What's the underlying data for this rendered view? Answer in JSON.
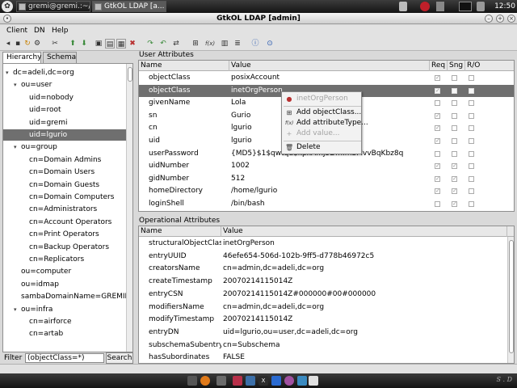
{
  "taskbar": {
    "tasks": [
      "gremi@gremi.:~/...",
      "GtkOL LDAP [a..."
    ],
    "clock": "12:50"
  },
  "window": {
    "title": "GtkOL LDAP [admin]"
  },
  "menu": [
    "Client",
    "DN",
    "Help"
  ],
  "tabs": [
    "Hierarchy",
    "Schema"
  ],
  "tree": [
    {
      "label": "dc=adeli,dc=org",
      "level": 0,
      "twisty": "expanded"
    },
    {
      "label": "ou=user",
      "level": 1,
      "twisty": "expanded"
    },
    {
      "label": "uid=nobody",
      "level": 2,
      "twisty": "none"
    },
    {
      "label": "uid=root",
      "level": 2,
      "twisty": "none"
    },
    {
      "label": "uid=gremi",
      "level": 2,
      "twisty": "none"
    },
    {
      "label": "uid=lgurio",
      "level": 2,
      "twisty": "none"
    },
    {
      "label": "ou=group",
      "level": 1,
      "twisty": "expanded"
    },
    {
      "label": "cn=Domain Admins",
      "level": 2,
      "twisty": "none"
    },
    {
      "label": "cn=Domain Users",
      "level": 2,
      "twisty": "none"
    },
    {
      "label": "cn=Domain Guests",
      "level": 2,
      "twisty": "none"
    },
    {
      "label": "cn=Domain Computers",
      "level": 2,
      "twisty": "none"
    },
    {
      "label": "cn=Administrators",
      "level": 2,
      "twisty": "none"
    },
    {
      "label": "cn=Account Operators",
      "level": 2,
      "twisty": "none"
    },
    {
      "label": "cn=Print Operators",
      "level": 2,
      "twisty": "none"
    },
    {
      "label": "cn=Backup Operators",
      "level": 2,
      "twisty": "none"
    },
    {
      "label": "cn=Replicators",
      "level": 2,
      "twisty": "none"
    },
    {
      "label": "ou=computer",
      "level": 1,
      "twisty": "none"
    },
    {
      "label": "ou=idmap",
      "level": 1,
      "twisty": "none"
    },
    {
      "label": "sambaDomainName=GREMIDO",
      "level": 1,
      "twisty": "none"
    },
    {
      "label": "ou=infra",
      "level": 1,
      "twisty": "expanded"
    },
    {
      "label": "cn=airforce",
      "level": 2,
      "twisty": "none"
    },
    {
      "label": "cn=artab",
      "level": 2,
      "twisty": "none"
    }
  ],
  "tree_selected": "uid=lgurio",
  "filter": {
    "label": "Filter :",
    "value": "(objectClass=*)",
    "search_label": "Search"
  },
  "user_attributes": {
    "title": "User Attributes",
    "columns": [
      "Name",
      "Value",
      "Req",
      "Sng",
      "R/O"
    ],
    "rows": [
      {
        "name": "objectClass",
        "value": "posixAccount",
        "req": true,
        "sng": false,
        "ro": false
      },
      {
        "name": "objectClass",
        "value": "inetOrgPerson",
        "req": true,
        "sng": false,
        "ro": false,
        "selected": true
      },
      {
        "name": "givenName",
        "value": "Lola",
        "req": false,
        "sng": false,
        "ro": false
      },
      {
        "name": "sn",
        "value": "Gurio",
        "req": true,
        "sng": false,
        "ro": false
      },
      {
        "name": "cn",
        "value": "lgurio",
        "req": true,
        "sng": false,
        "ro": false
      },
      {
        "name": "uid",
        "value": "lgurio",
        "req": true,
        "sng": false,
        "ro": false
      },
      {
        "name": "userPassword",
        "value": "{MD5}$1$qwtqd$kpxAmj5Dm.mSMvvBqKbz8q",
        "req": false,
        "sng": false,
        "ro": false
      },
      {
        "name": "uidNumber",
        "value": "1002",
        "req": true,
        "sng": true,
        "ro": false
      },
      {
        "name": "gidNumber",
        "value": "512",
        "req": true,
        "sng": true,
        "ro": false
      },
      {
        "name": "homeDirectory",
        "value": "/home/lgurio",
        "req": true,
        "sng": true,
        "ro": false
      },
      {
        "name": "loginShell",
        "value": "/bin/bash",
        "req": false,
        "sng": true,
        "ro": false
      }
    ]
  },
  "context_menu": {
    "header": "inetOrgPerson",
    "items": [
      {
        "label": "Add objectClass...",
        "icon": "grid-icon",
        "enabled": true
      },
      {
        "label": "Add attributeType...",
        "icon": "function-icon",
        "enabled": true
      },
      {
        "label": "Add value...",
        "icon": "add-value-icon",
        "enabled": false
      },
      {
        "label": "Delete",
        "icon": "trash-icon",
        "enabled": true
      }
    ]
  },
  "operational_attributes": {
    "title": "Operational Attributes",
    "columns": [
      "Name",
      "Value"
    ],
    "rows": [
      {
        "name": "structuralObjectClass",
        "value": "inetOrgPerson"
      },
      {
        "name": "entryUUID",
        "value": "46efe654-506d-102b-9ff5-d778b46972c5"
      },
      {
        "name": "creatorsName",
        "value": "cn=admin,dc=adeli,dc=org"
      },
      {
        "name": "createTimestamp",
        "value": "20070214115014Z"
      },
      {
        "name": "entryCSN",
        "value": "20070214115014Z#000000#00#000000"
      },
      {
        "name": "modifiersName",
        "value": "cn=admin,dc=adeli,dc=org"
      },
      {
        "name": "modifyTimestamp",
        "value": "20070214115014Z"
      },
      {
        "name": "entryDN",
        "value": "uid=lgurio,ou=user,dc=adeli,dc=org"
      },
      {
        "name": "subschemaSubentry",
        "value": "cn=Subschema"
      },
      {
        "name": "hasSubordinates",
        "value": "FALSE"
      }
    ]
  },
  "colors": {
    "selection": "#6f6f6f",
    "taskbar": "#1e1e1e"
  }
}
